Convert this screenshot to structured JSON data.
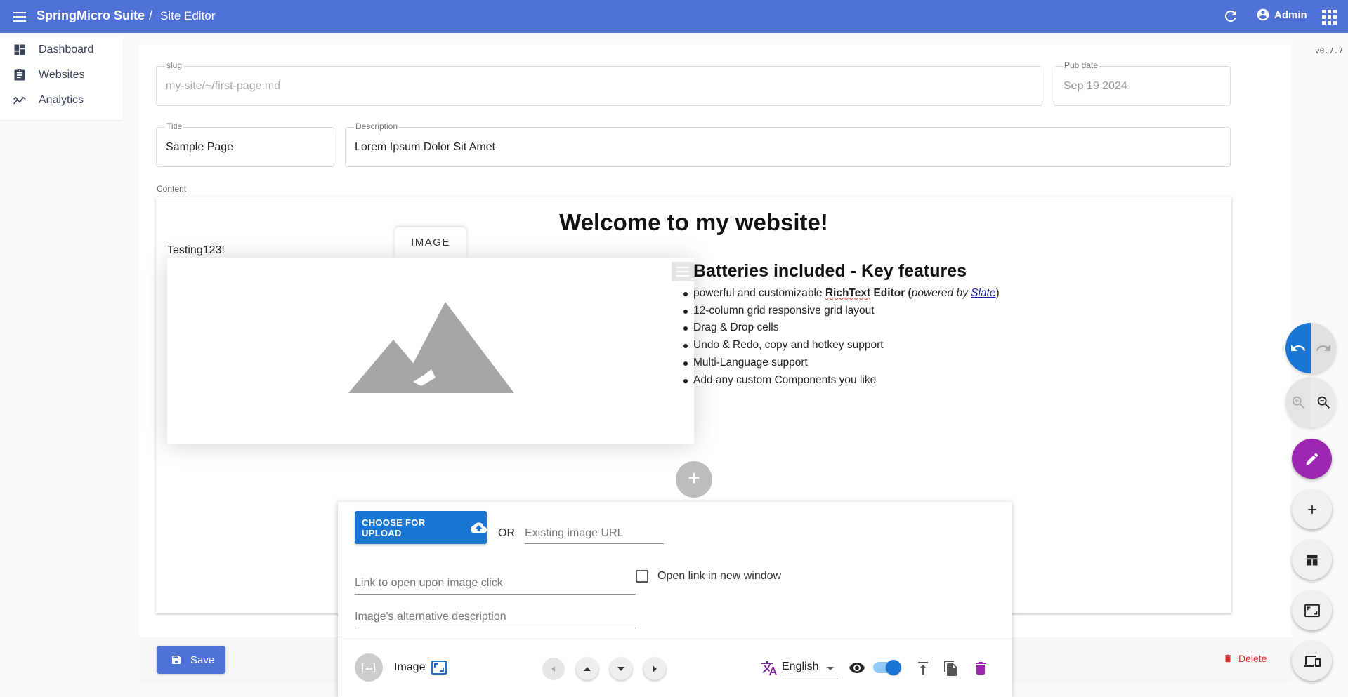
{
  "header": {
    "brand": "SpringMicro Suite",
    "separator": "/",
    "page": "Site Editor",
    "user": "Admin",
    "icons": [
      "menu-icon",
      "refresh-icon",
      "account-icon",
      "apps-grid-icon"
    ]
  },
  "sidebar": {
    "items": [
      {
        "label": "Dashboard",
        "icon": "dashboard-icon"
      },
      {
        "label": "Websites",
        "icon": "clipboard-icon"
      },
      {
        "label": "Analytics",
        "icon": "analytics-icon"
      }
    ]
  },
  "version": "v0.7.7",
  "form": {
    "slug_label": "slug",
    "slug_placeholder": "my-site/~/first-page.md",
    "pubdate_label": "Pub date",
    "pubdate_value": "Sep 19 2024",
    "title_label": "Title",
    "title_value": "Sample Page",
    "description_label": "Description",
    "description_value": "Lorem Ipsum Dolor Sit Amet",
    "content_label": "Content"
  },
  "content": {
    "heading": "Welcome to my website!",
    "testing_text": "Testing123!",
    "image_tab": "IMAGE",
    "features_title": "Batteries included - Key features",
    "feature_1_pre": "powerful and customizable ",
    "feature_1_richtext": "RichText",
    "feature_1_editor": " Editor (",
    "feature_1_powered": "powered by ",
    "feature_1_slate": "Slate",
    "feature_1_close": ")",
    "features": [
      "12-column grid responsive grid layout",
      "Drag & Drop cells",
      "Undo & Redo, copy and hotkey support",
      "Multi-Language support",
      "Add any custom Components you like"
    ],
    "add_cell": "+"
  },
  "image_panel": {
    "upload_label": "CHOOSE FOR UPLOAD",
    "or": "OR",
    "url_placeholder": "Existing image URL",
    "link_placeholder": "Link to open upon image click",
    "new_window_label": "Open link in new window",
    "alt_placeholder": "Image's alternative description",
    "plugin_label": "Image",
    "language": "English",
    "visible": true
  },
  "actions": {
    "save": "Save",
    "delete": "Delete"
  },
  "colors": {
    "appbar": "#4f70d4",
    "primary": "#1976d2",
    "edit_fab": "#9c27b0",
    "delete": "#d32f2f"
  }
}
